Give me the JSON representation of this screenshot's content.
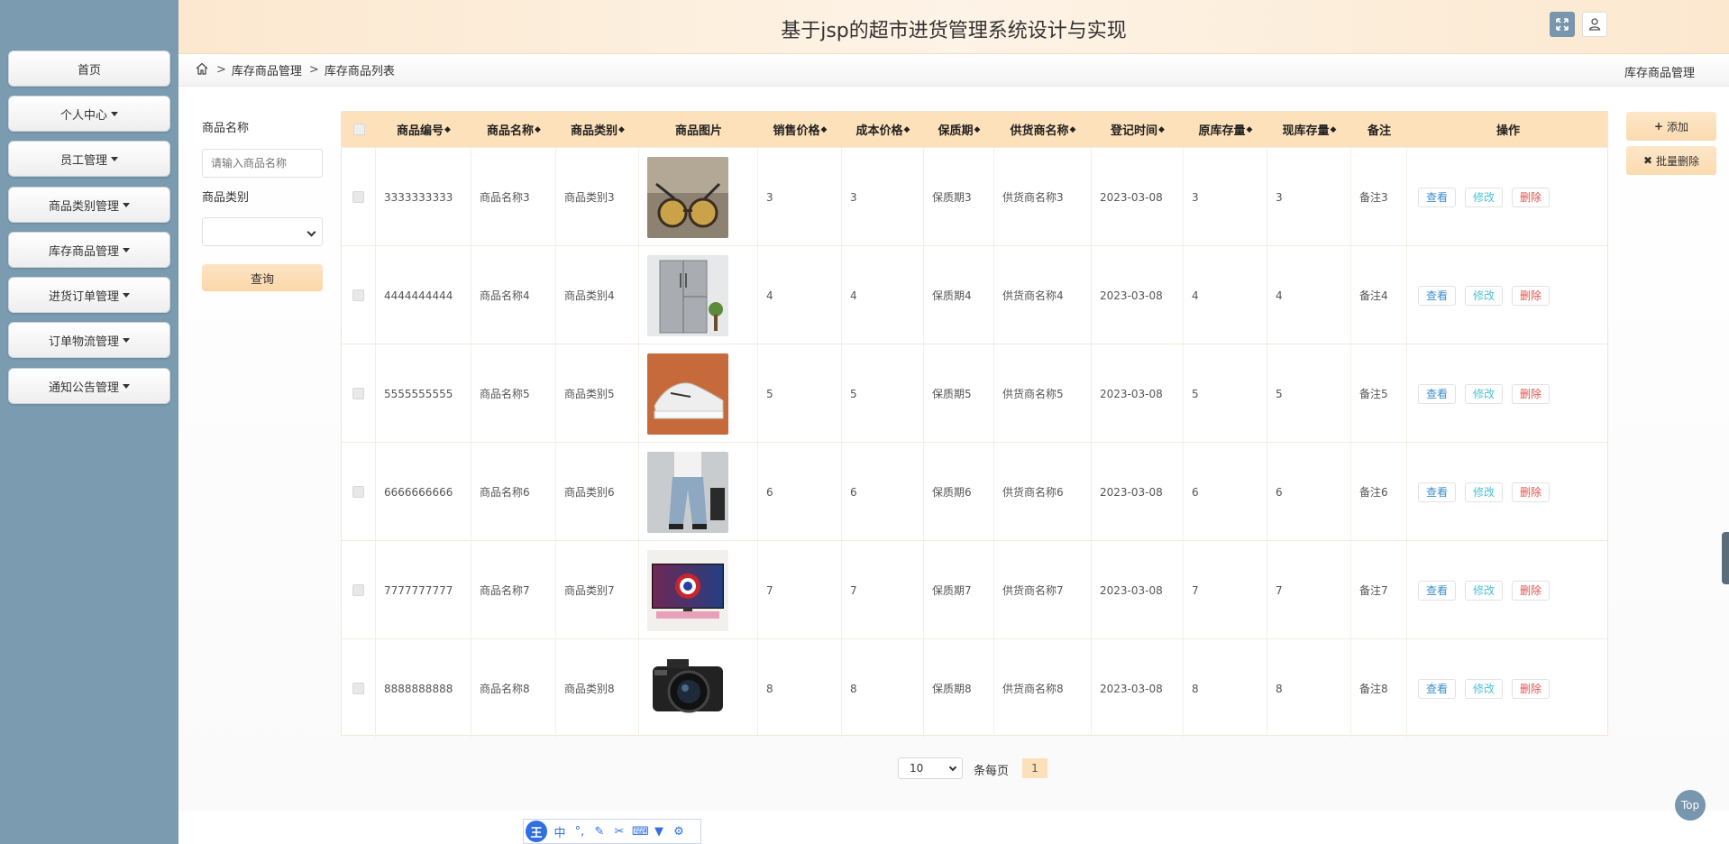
{
  "app": {
    "title": "基于jsp的超市进货管理系统设计与实现"
  },
  "header": {
    "expand_icon": "expand-icon",
    "user_icon": "user-icon"
  },
  "sidebar": {
    "items": [
      {
        "label": "首页",
        "dropdown": false
      },
      {
        "label": "个人中心",
        "dropdown": true
      },
      {
        "label": "员工管理",
        "dropdown": true
      },
      {
        "label": "商品类别管理",
        "dropdown": true
      },
      {
        "label": "库存商品管理",
        "dropdown": true
      },
      {
        "label": "进货订单管理",
        "dropdown": true
      },
      {
        "label": "订单物流管理",
        "dropdown": true
      },
      {
        "label": "通知公告管理",
        "dropdown": true
      }
    ]
  },
  "breadcrumb": {
    "level1": "库存商品管理",
    "level2": "库存商品列表",
    "right_label": "库存商品管理"
  },
  "filter": {
    "name_label": "商品名称",
    "name_placeholder": "请输入商品名称",
    "category_label": "商品类别",
    "category_value": "",
    "query_label": "查询"
  },
  "actions": {
    "add_label": "添加",
    "batch_delete_label": "批量删除"
  },
  "table": {
    "columns": [
      "商品编号",
      "商品名称",
      "商品类别",
      "商品图片",
      "销售价格",
      "成本价格",
      "保质期",
      "供货商名称",
      "登记时间",
      "原库存量",
      "现库存量",
      "备注",
      "操作"
    ],
    "sortable": [
      true,
      true,
      true,
      false,
      true,
      true,
      true,
      true,
      true,
      true,
      true,
      false,
      false
    ],
    "row_actions": {
      "view": "查看",
      "edit": "修改",
      "delete": "删除"
    },
    "rows": [
      {
        "id": "3333333333",
        "name": "商品名称3",
        "category": "商品类别3",
        "image": "sunglasses",
        "sale_price": "3",
        "cost_price": "3",
        "shelf_life": "保质期3",
        "supplier": "供货商名称3",
        "date": "2023-03-08",
        "orig_stock": "3",
        "cur_stock": "3",
        "remark": "备注3"
      },
      {
        "id": "4444444444",
        "name": "商品名称4",
        "category": "商品类别4",
        "image": "refrigerator",
        "sale_price": "4",
        "cost_price": "4",
        "shelf_life": "保质期4",
        "supplier": "供货商名称4",
        "date": "2023-03-08",
        "orig_stock": "4",
        "cur_stock": "4",
        "remark": "备注4"
      },
      {
        "id": "5555555555",
        "name": "商品名称5",
        "category": "商品类别5",
        "image": "sneaker",
        "sale_price": "5",
        "cost_price": "5",
        "shelf_life": "保质期5",
        "supplier": "供货商名称5",
        "date": "2023-03-08",
        "orig_stock": "5",
        "cur_stock": "5",
        "remark": "备注5"
      },
      {
        "id": "6666666666",
        "name": "商品名称6",
        "category": "商品类别6",
        "image": "jeans",
        "sale_price": "6",
        "cost_price": "6",
        "shelf_life": "保质期6",
        "supplier": "供货商名称6",
        "date": "2023-03-08",
        "orig_stock": "6",
        "cur_stock": "6",
        "remark": "备注6"
      },
      {
        "id": "7777777777",
        "name": "商品名称7",
        "category": "商品类别7",
        "image": "monitor",
        "sale_price": "7",
        "cost_price": "7",
        "shelf_life": "保质期7",
        "supplier": "供货商名称7",
        "date": "2023-03-08",
        "orig_stock": "7",
        "cur_stock": "7",
        "remark": "备注7"
      },
      {
        "id": "8888888888",
        "name": "商品名称8",
        "category": "商品类别8",
        "image": "camera",
        "sale_price": "8",
        "cost_price": "8",
        "shelf_life": "保质期8",
        "supplier": "供货商名称8",
        "date": "2023-03-08",
        "orig_stock": "8",
        "cur_stock": "8",
        "remark": "备注8"
      }
    ]
  },
  "pagination": {
    "page_size": "10",
    "per_page_label": "条每页",
    "current_page": "1"
  },
  "top_button": "Top",
  "ime": {
    "logo": "王",
    "mode": "中"
  },
  "colors": {
    "sidebar_bg": "#7a9bb0",
    "header_bg": "#fce8cf",
    "table_header_bg": "#fde1ba",
    "view_color": "#3b8fd0",
    "edit_color": "#4cc3d4",
    "delete_color": "#e0554d"
  }
}
